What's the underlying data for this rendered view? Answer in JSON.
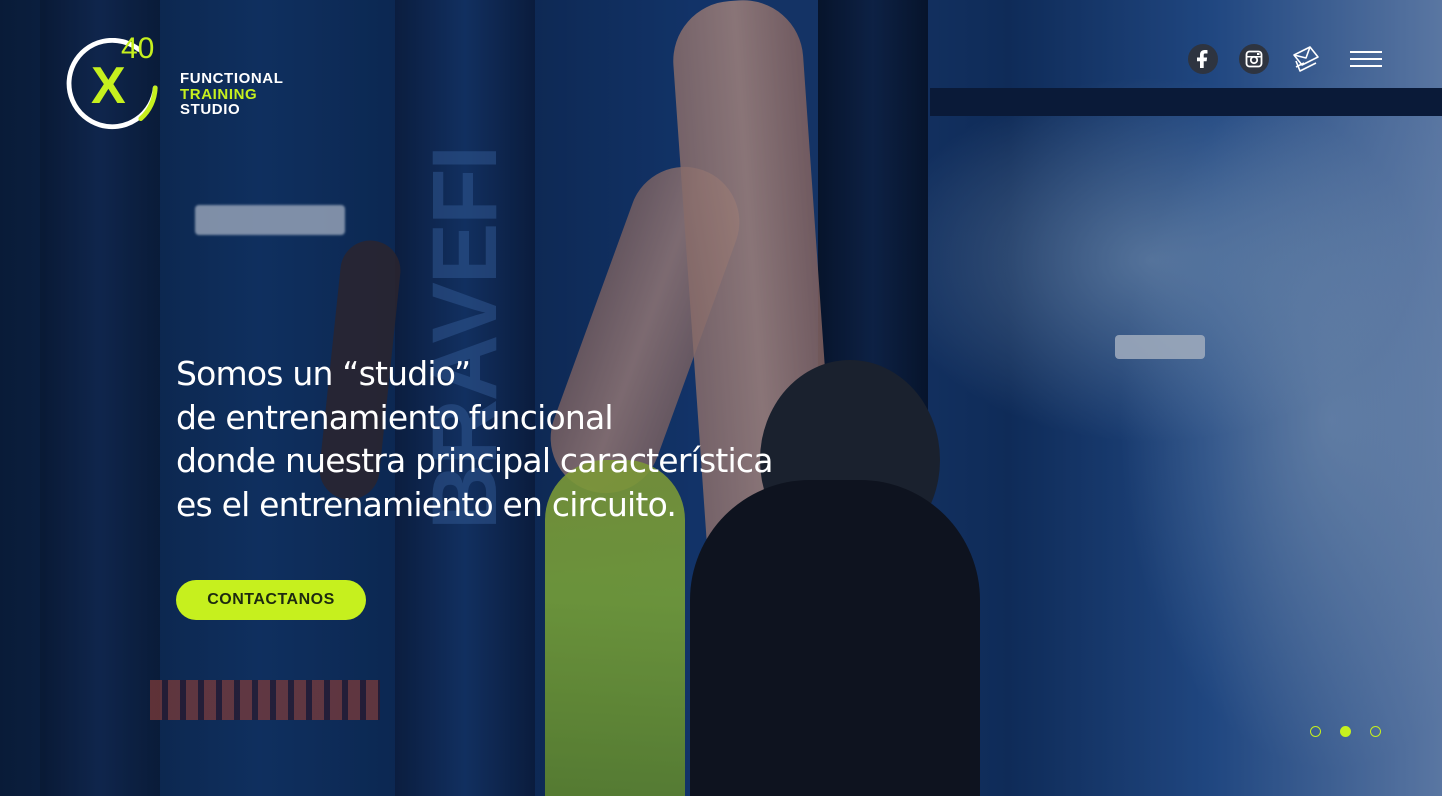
{
  "brand": {
    "logo_letter": "X",
    "logo_number": "40",
    "line1": "FUNCTIONAL",
    "line2": "TRAINING",
    "line3": "STUDIO",
    "accent_color": "#c6f01e"
  },
  "nav": {
    "icons": [
      "facebook-icon",
      "instagram-icon",
      "mail-icon",
      "menu-icon"
    ]
  },
  "hero": {
    "headline_lines": [
      "Somos un “studio”",
      "de entrenamiento funcional",
      "donde nuestra principal característica",
      "es el entrenamiento en circuito."
    ],
    "cta_label": "CONTACTANOS",
    "background_banner_text": "BRAVEFI"
  },
  "slider": {
    "slide_count": 3,
    "active_index": 1
  }
}
